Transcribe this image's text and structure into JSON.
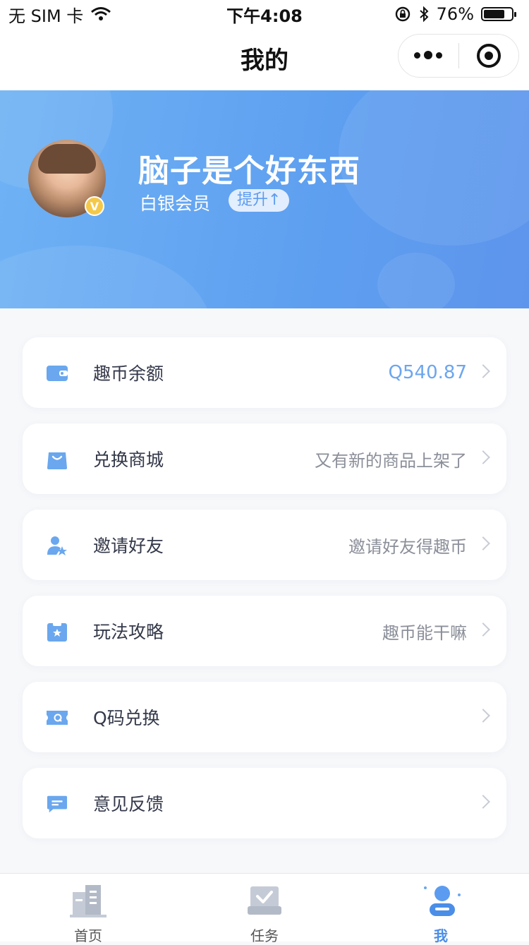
{
  "status_bar": {
    "carrier": "无 SIM 卡",
    "time": "下午4:08",
    "battery_percent": "76%",
    "battery_level": 0.76
  },
  "nav": {
    "title": "我的"
  },
  "profile": {
    "name": "脑子是个好东西",
    "level": "白银会员",
    "upgrade_label": "提升↑",
    "badge": "V"
  },
  "menu": [
    {
      "label": "趣币余额",
      "value": "Q540.87",
      "icon": "wallet-icon"
    },
    {
      "label": "兑换商城",
      "value": "又有新的商品上架了",
      "icon": "shopping-bag-icon"
    },
    {
      "label": "邀请好友",
      "value": "邀请好友得趣币",
      "icon": "user-star-icon"
    },
    {
      "label": "玩法攻略",
      "value": "趣币能干嘛",
      "icon": "guide-book-icon"
    },
    {
      "label": "Q码兑换",
      "value": "",
      "icon": "ticket-icon"
    },
    {
      "label": "意见反馈",
      "value": "",
      "icon": "message-icon"
    }
  ],
  "tabs": [
    {
      "label": "首页",
      "icon": "building-icon",
      "active": false
    },
    {
      "label": "任务",
      "icon": "task-check-icon",
      "active": false
    },
    {
      "label": "我",
      "icon": "profile-icon",
      "active": true
    }
  ],
  "colors": {
    "accent": "#5e9ff0",
    "tab_active": "#4a8ee8"
  }
}
